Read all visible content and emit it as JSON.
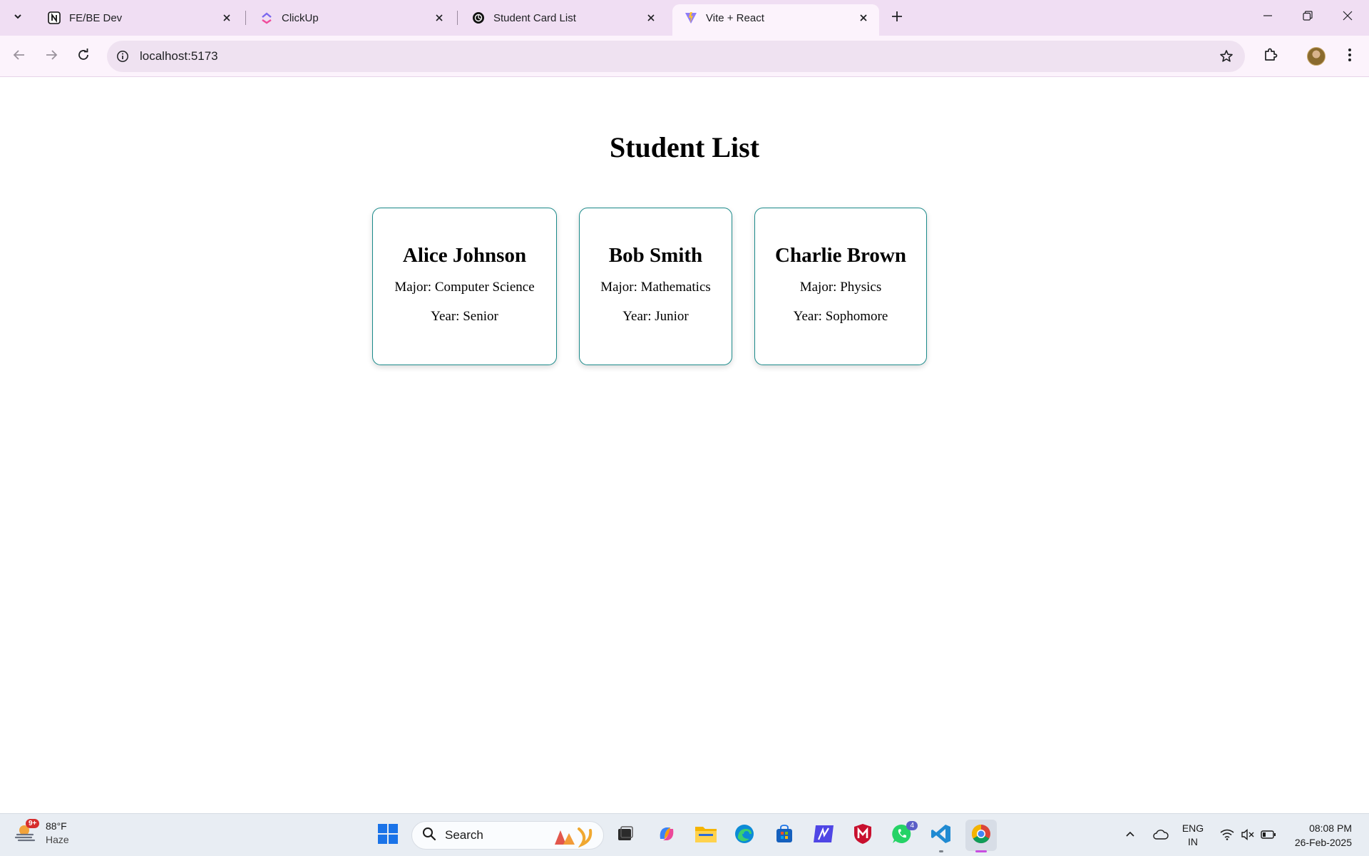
{
  "browser": {
    "tabs": [
      {
        "title": "FE/BE Dev",
        "favicon": "notion-icon",
        "active": false
      },
      {
        "title": "ClickUp",
        "favicon": "clickup-icon",
        "active": false
      },
      {
        "title": "Student Card List",
        "favicon": "openai-icon",
        "active": false
      },
      {
        "title": "Vite + React",
        "favicon": "vite-icon",
        "active": true
      }
    ],
    "url": "localhost:5173"
  },
  "page": {
    "heading": "Student List",
    "students": [
      {
        "name": "Alice Johnson",
        "major": "Major: Computer Science",
        "year": "Year: Senior"
      },
      {
        "name": "Bob Smith",
        "major": "Major: Mathematics",
        "year": "Year: Junior"
      },
      {
        "name": "Charlie Brown",
        "major": "Major: Physics",
        "year": "Year: Sophomore"
      }
    ]
  },
  "taskbar": {
    "weather": {
      "temp": "88°F",
      "condition": "Haze",
      "badge": "9+"
    },
    "search_label": "Search",
    "whatsapp_badge": "4",
    "language": {
      "line1": "ENG",
      "line2": "IN"
    },
    "clock": {
      "time": "08:08 PM",
      "date": "26-Feb-2025"
    }
  },
  "colors": {
    "tabstrip": "#f0def3",
    "toolbar": "#fcf3fc",
    "card_border": "#1b8a8a",
    "taskbar": "#e8edf3"
  }
}
